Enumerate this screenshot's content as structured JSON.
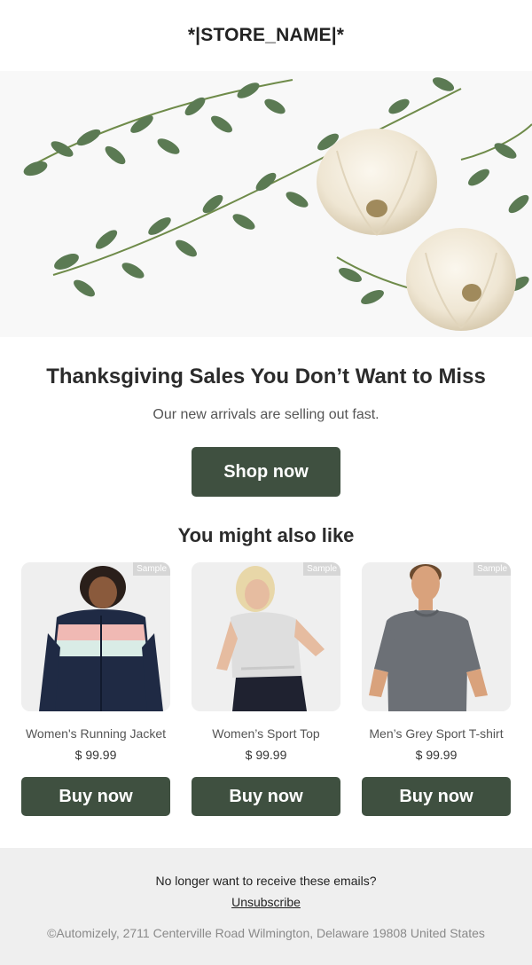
{
  "header": {
    "store_name": "*|STORE_NAME|*"
  },
  "hero": {
    "image": "thanksgiving-pumpkins-eucalyptus"
  },
  "promo": {
    "headline": "Thanksgiving Sales You Don’t Want to Miss",
    "subtext": "Our new arrivals are selling out fast.",
    "cta_label": "Shop now"
  },
  "recommendations": {
    "title": "You might also like",
    "products": [
      {
        "name": "Women's Running Jacket",
        "price": "$ 99.99",
        "tag": "Sample",
        "button": "Buy now"
      },
      {
        "name": "Women’s Sport Top",
        "price": "$ 99.99",
        "tag": "Sample",
        "button": "Buy now"
      },
      {
        "name": "Men’s Grey Sport T-shirt",
        "price": "$ 99.99",
        "tag": "Sample",
        "button": "Buy now"
      }
    ]
  },
  "footer": {
    "note": "No longer want to receive these emails?",
    "unsubscribe": "Unsubscribe",
    "address": "©Automizely, 2711 Centerville Road Wilmington, Delaware 19808 United States"
  },
  "colors": {
    "button": "#3f5040",
    "footer_bg": "#efefef"
  }
}
